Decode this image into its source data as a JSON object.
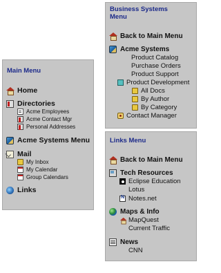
{
  "main_menu": {
    "title": "Main Menu",
    "home": "Home",
    "directories": "Directories",
    "directory_items": [
      "Acme Employees",
      "Acme Contact Mgr",
      "Personal Addresses"
    ],
    "acme_systems_menu": "Acme Systems Menu",
    "mail": "Mail",
    "mail_items": [
      "My Inbox",
      "My Calendar",
      "Group Calendars"
    ],
    "links": "Links"
  },
  "business_menu": {
    "title_line1": "Business Systems",
    "title_line2": "Menu",
    "back": "Back to Main Menu",
    "acme_systems": "Acme Systems",
    "items": [
      "Product Catalog",
      "Purchase Orders",
      "Product Support",
      "Product Development"
    ],
    "dev_items": [
      "All Docs",
      "By Author",
      "By Category"
    ],
    "contact_manager": "Contact Manager"
  },
  "links_menu": {
    "title": "Links Menu",
    "back": "Back to Main Menu",
    "tech_resources": "Tech Resources",
    "tech_items": [
      "Eclipse Education",
      "Lotus",
      "Notes.net"
    ],
    "maps_info": "Maps & Info",
    "maps_items": [
      "MapQuest",
      "Current Traffic"
    ],
    "news": "News",
    "news_items": [
      "CNN"
    ]
  },
  "colors": {
    "panel_bg": "#c6c6c6",
    "title_color": "#1c2a8a"
  }
}
